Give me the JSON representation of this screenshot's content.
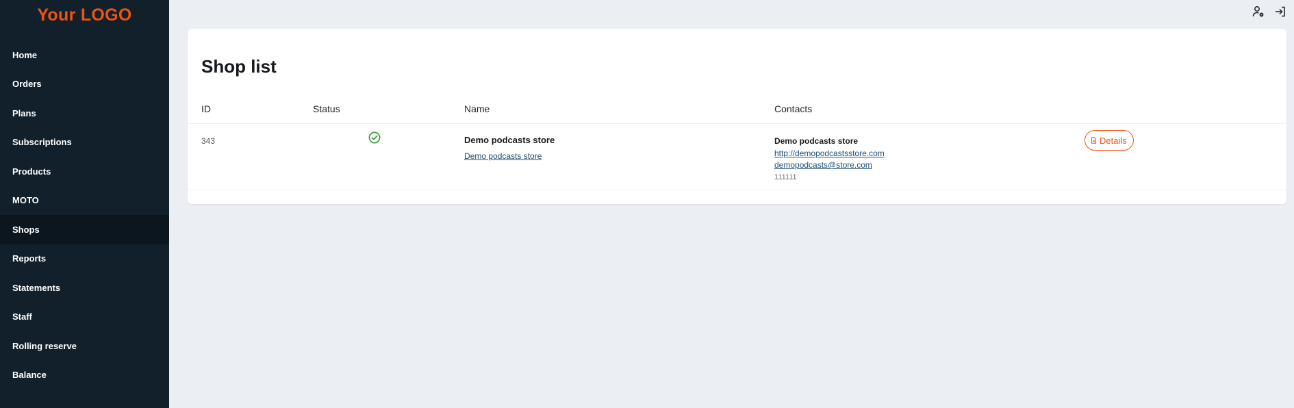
{
  "logo": "Your LOGO",
  "sidebar": {
    "items": [
      {
        "label": "Home"
      },
      {
        "label": "Orders"
      },
      {
        "label": "Plans"
      },
      {
        "label": "Subscriptions"
      },
      {
        "label": "Products"
      },
      {
        "label": "MOTO"
      },
      {
        "label": "Shops",
        "active": true
      },
      {
        "label": "Reports"
      },
      {
        "label": "Statements"
      },
      {
        "label": "Staff"
      },
      {
        "label": "Rolling reserve"
      },
      {
        "label": "Balance"
      }
    ]
  },
  "topbar": {
    "icons": [
      "user-settings-icon",
      "logout-icon"
    ]
  },
  "page": {
    "title": "Shop list"
  },
  "table": {
    "columns": [
      "ID",
      "Status",
      "Name",
      "Contacts"
    ],
    "rows": [
      {
        "id": "343",
        "status_icon": "check-circle-icon",
        "name": "Demo podcasts store",
        "name_link": "Demo podcasts store",
        "contact_name": "Demo podcasts store",
        "contact_url": "http://demopodcastsstore.com",
        "contact_email": "demopodcasts@store.com",
        "contact_phone": "111111",
        "action_label": "Details"
      }
    ]
  },
  "colors": {
    "accent": "#f0530f",
    "sidebar_bg": "#12202b",
    "sidebar_active_bg": "#0c161e",
    "link": "#1e4f73",
    "status_ok": "#3f9a3a"
  }
}
